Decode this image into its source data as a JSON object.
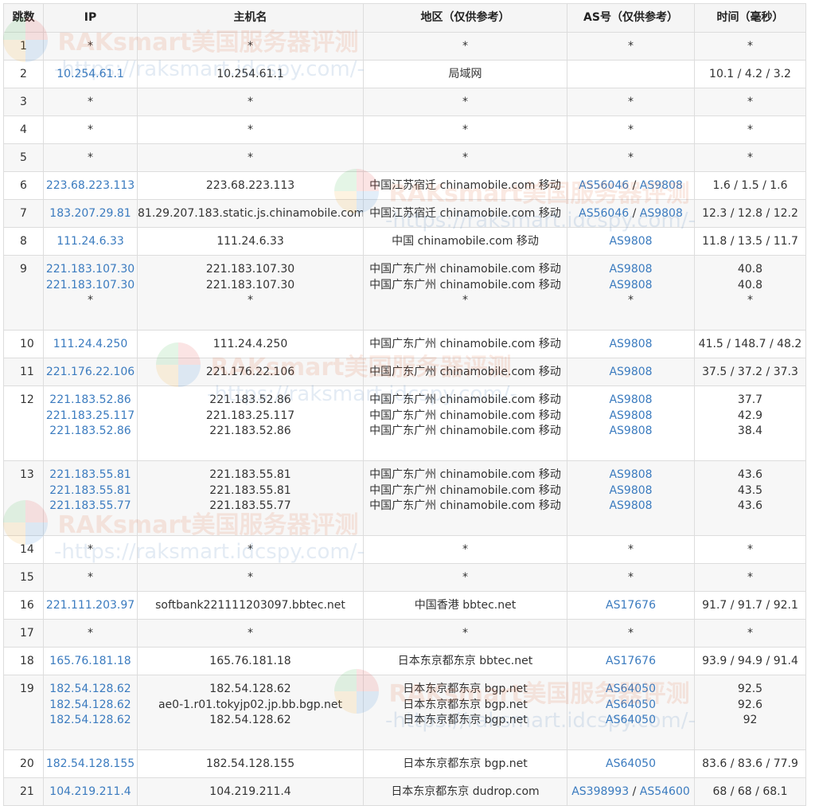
{
  "headers": [
    "跳数",
    "IP",
    "主机名",
    "地区（仅供参考）",
    "AS号（仅供参考）",
    "时间（毫秒）"
  ],
  "watermark": {
    "title": "RAKsmart美国服务器评测",
    "url": "-https://raksmart.idcspy.com/-"
  },
  "rows": [
    {
      "hop": "1",
      "ip": [
        "*"
      ],
      "host": [
        "*"
      ],
      "region": [
        "*"
      ],
      "as": [
        [
          "*"
        ]
      ],
      "time": [
        "*"
      ]
    },
    {
      "hop": "2",
      "ip": [
        "10.254.61.1"
      ],
      "host": [
        "10.254.61.1"
      ],
      "region": [
        "局域网"
      ],
      "as": [
        []
      ],
      "time": [
        "10.1 / 4.2 / 3.2"
      ]
    },
    {
      "hop": "3",
      "ip": [
        "*"
      ],
      "host": [
        "*"
      ],
      "region": [
        "*"
      ],
      "as": [
        [
          "*"
        ]
      ],
      "time": [
        "*"
      ]
    },
    {
      "hop": "4",
      "ip": [
        "*"
      ],
      "host": [
        "*"
      ],
      "region": [
        "*"
      ],
      "as": [
        [
          "*"
        ]
      ],
      "time": [
        "*"
      ]
    },
    {
      "hop": "5",
      "ip": [
        "*"
      ],
      "host": [
        "*"
      ],
      "region": [
        "*"
      ],
      "as": [
        [
          "*"
        ]
      ],
      "time": [
        "*"
      ]
    },
    {
      "hop": "6",
      "ip": [
        "223.68.223.113"
      ],
      "host": [
        "223.68.223.113"
      ],
      "region": [
        "中国江苏宿迁 chinamobile.com 移动"
      ],
      "as": [
        [
          "AS56046",
          "AS9808"
        ]
      ],
      "time": [
        "1.6 / 1.5 / 1.6"
      ]
    },
    {
      "hop": "7",
      "ip": [
        "183.207.29.81"
      ],
      "host": [
        "81.29.207.183.static.js.chinamobile.com"
      ],
      "region": [
        "中国江苏宿迁 chinamobile.com 移动"
      ],
      "as": [
        [
          "AS56046",
          "AS9808"
        ]
      ],
      "time": [
        "12.3 / 12.8 / 12.2"
      ]
    },
    {
      "hop": "8",
      "ip": [
        "111.24.6.33"
      ],
      "host": [
        "111.24.6.33"
      ],
      "region": [
        "中国 chinamobile.com 移动"
      ],
      "as": [
        [
          "AS9808"
        ]
      ],
      "time": [
        "11.8 / 13.5 / 11.7"
      ]
    },
    {
      "hop": "9",
      "ip": [
        "221.183.107.30",
        "221.183.107.30",
        "*"
      ],
      "host": [
        "221.183.107.30",
        "221.183.107.30",
        "*"
      ],
      "region": [
        "中国广东广州 chinamobile.com 移动",
        "中国广东广州 chinamobile.com 移动",
        "*"
      ],
      "as": [
        [
          "AS9808"
        ],
        [
          "AS9808"
        ],
        [
          "*"
        ]
      ],
      "time": [
        "40.8",
        "40.8",
        "*"
      ]
    },
    {
      "hop": "10",
      "ip": [
        "111.24.4.250"
      ],
      "host": [
        "111.24.4.250"
      ],
      "region": [
        "中国广东广州 chinamobile.com 移动"
      ],
      "as": [
        [
          "AS9808"
        ]
      ],
      "time": [
        "41.5 / 148.7 / 48.2"
      ]
    },
    {
      "hop": "11",
      "ip": [
        "221.176.22.106"
      ],
      "host": [
        "221.176.22.106"
      ],
      "region": [
        "中国广东广州 chinamobile.com 移动"
      ],
      "as": [
        [
          "AS9808"
        ]
      ],
      "time": [
        "37.5 / 37.2 / 37.3"
      ]
    },
    {
      "hop": "12",
      "ip": [
        "221.183.52.86",
        "221.183.25.117",
        "221.183.52.86"
      ],
      "host": [
        "221.183.52.86",
        "221.183.25.117",
        "221.183.52.86"
      ],
      "region": [
        "中国广东广州 chinamobile.com 移动",
        "中国广东广州 chinamobile.com 移动",
        "中国广东广州 chinamobile.com 移动"
      ],
      "as": [
        [
          "AS9808"
        ],
        [
          "AS9808"
        ],
        [
          "AS9808"
        ]
      ],
      "time": [
        "37.7",
        "42.9",
        "38.4"
      ]
    },
    {
      "hop": "13",
      "ip": [
        "221.183.55.81",
        "221.183.55.81",
        "221.183.55.77"
      ],
      "host": [
        "221.183.55.81",
        "221.183.55.81",
        "221.183.55.77"
      ],
      "region": [
        "中国广东广州 chinamobile.com 移动",
        "中国广东广州 chinamobile.com 移动",
        "中国广东广州 chinamobile.com 移动"
      ],
      "as": [
        [
          "AS9808"
        ],
        [
          "AS9808"
        ],
        [
          "AS9808"
        ]
      ],
      "time": [
        "43.6",
        "43.5",
        "43.6"
      ]
    },
    {
      "hop": "14",
      "ip": [
        "*"
      ],
      "host": [
        "*"
      ],
      "region": [
        "*"
      ],
      "as": [
        [
          "*"
        ]
      ],
      "time": [
        "*"
      ]
    },
    {
      "hop": "15",
      "ip": [
        "*"
      ],
      "host": [
        "*"
      ],
      "region": [
        "*"
      ],
      "as": [
        [
          "*"
        ]
      ],
      "time": [
        "*"
      ]
    },
    {
      "hop": "16",
      "ip": [
        "221.111.203.97"
      ],
      "host": [
        "softbank221111203097.bbtec.net"
      ],
      "region": [
        "中国香港 bbtec.net"
      ],
      "as": [
        [
          "AS17676"
        ]
      ],
      "time": [
        "91.7 / 91.7 / 92.1"
      ]
    },
    {
      "hop": "17",
      "ip": [
        "*"
      ],
      "host": [
        "*"
      ],
      "region": [
        "*"
      ],
      "as": [
        [
          "*"
        ]
      ],
      "time": [
        "*"
      ]
    },
    {
      "hop": "18",
      "ip": [
        "165.76.181.18"
      ],
      "host": [
        "165.76.181.18"
      ],
      "region": [
        "日本东京都东京 bbtec.net"
      ],
      "as": [
        [
          "AS17676"
        ]
      ],
      "time": [
        "93.9 / 94.9 / 91.4"
      ]
    },
    {
      "hop": "19",
      "ip": [
        "182.54.128.62",
        "182.54.128.62",
        "182.54.128.62"
      ],
      "host": [
        "182.54.128.62",
        "ae0-1.r01.tokyjp02.jp.bb.bgp.net",
        "182.54.128.62"
      ],
      "region": [
        "日本东京都东京 bgp.net",
        "日本东京都东京 bgp.net",
        "日本东京都东京 bgp.net"
      ],
      "as": [
        [
          "AS64050"
        ],
        [
          "AS64050"
        ],
        [
          "AS64050"
        ]
      ],
      "time": [
        "92.5",
        "92.6",
        "92"
      ]
    },
    {
      "hop": "20",
      "ip": [
        "182.54.128.155"
      ],
      "host": [
        "182.54.128.155"
      ],
      "region": [
        "日本东京都东京 bgp.net"
      ],
      "as": [
        [
          "AS64050"
        ]
      ],
      "time": [
        "83.6 / 83.6 / 77.9"
      ]
    },
    {
      "hop": "21",
      "ip": [
        "104.219.211.4"
      ],
      "host": [
        "104.219.211.4"
      ],
      "region": [
        "日本东京都东京 dudrop.com"
      ],
      "as": [
        [
          "AS398993",
          "AS54600"
        ]
      ],
      "time": [
        "68 / 68 / 68.1"
      ]
    }
  ]
}
